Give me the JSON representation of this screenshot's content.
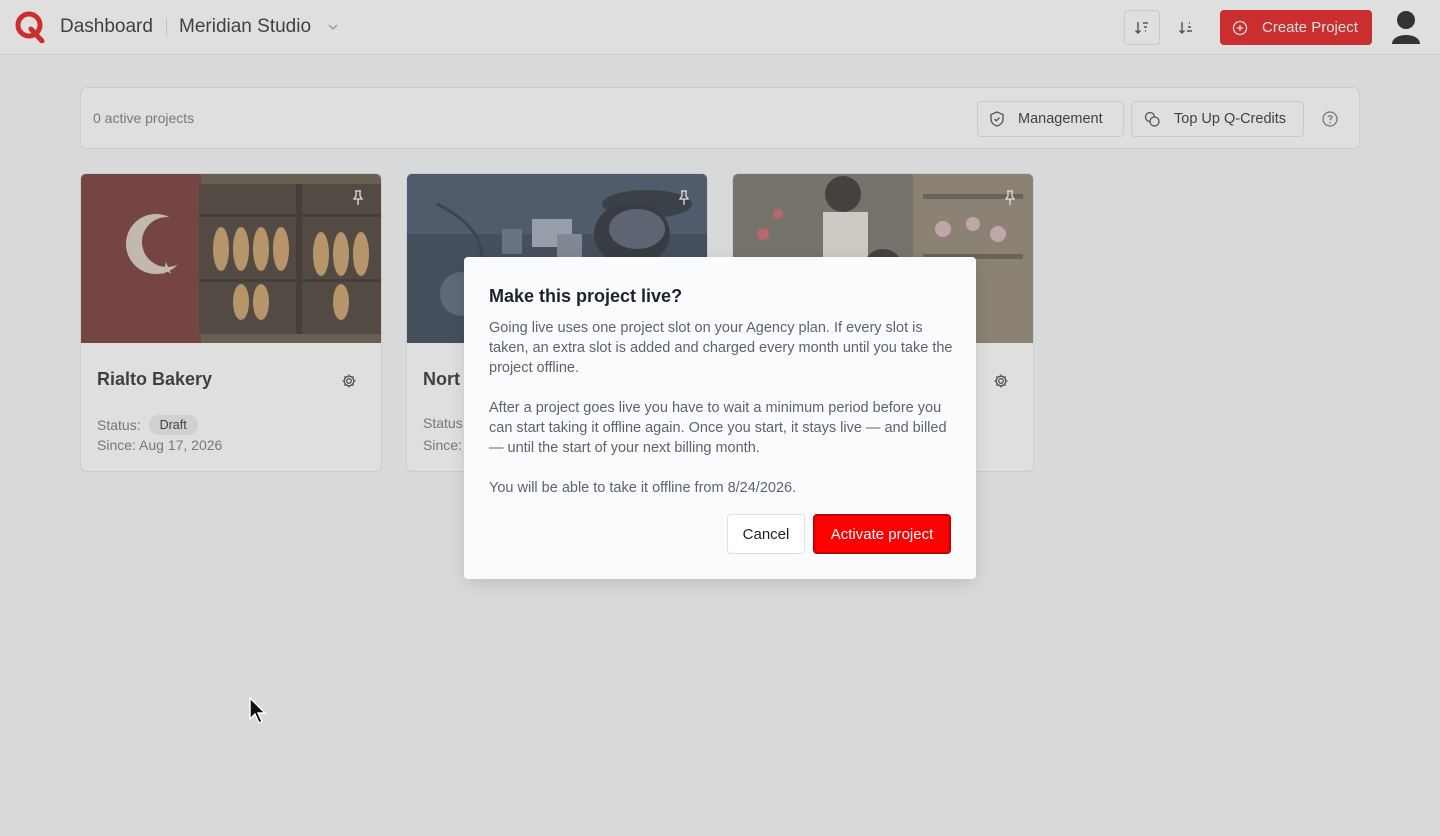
{
  "header": {
    "title": "Dashboard",
    "org_name": "Meridian Studio",
    "create_label": "Create Project"
  },
  "toolbar": {
    "active_count": "0 active projects",
    "management_label": "Management",
    "topup_label": "Top Up Q-Credits"
  },
  "cards": [
    {
      "title": "Rialto Bakery",
      "status_label": "Status:",
      "status": "Draft",
      "since": "Since: Aug 17, 2026"
    },
    {
      "title": "Nort",
      "status_label": "Status",
      "since": "Since:"
    },
    {
      "title": "",
      "status_label": "",
      "since": ""
    }
  ],
  "modal": {
    "title": "Make this project live?",
    "p1": "Going live uses one project slot on your Agency plan. If every slot is taken, an extra slot is added and charged every month until you take the project offline.",
    "p2": "After a project goes live you have to wait a minimum period before you can start taking it offline again. Once you start, it stays live — and billed — until the start of your next billing month.",
    "p3": "You will be able to take it offline from 8/24/2026.",
    "cancel_label": "Cancel",
    "activate_label": "Activate project"
  },
  "colors": {
    "accent": "#e40b0b",
    "activate": "#ff0000"
  }
}
